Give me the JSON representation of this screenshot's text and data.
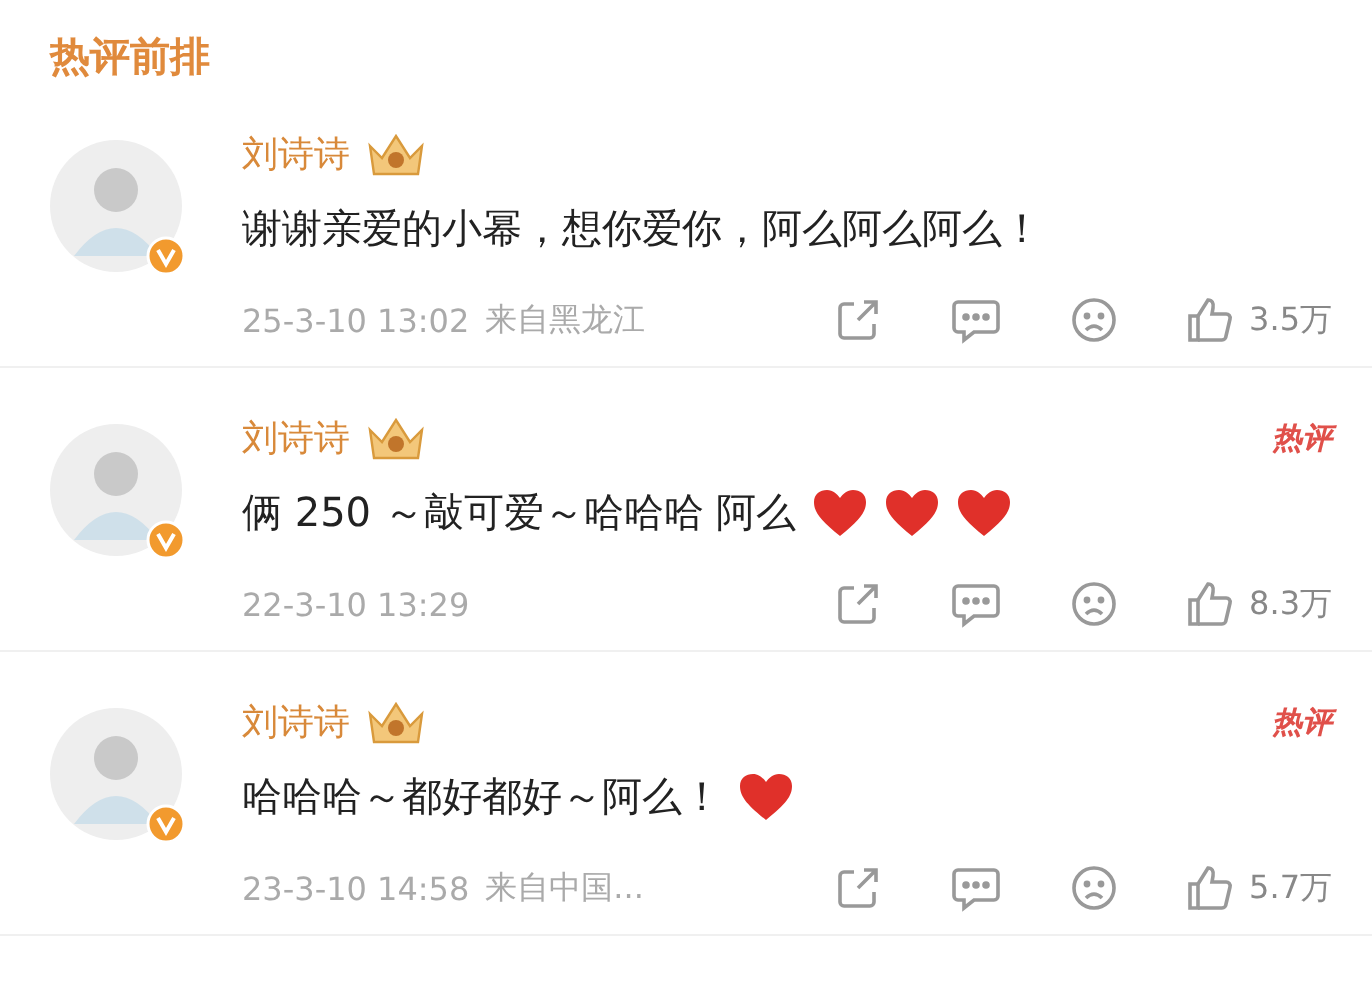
{
  "header": {
    "title": "热评前排"
  },
  "comments": [
    {
      "user": "刘诗诗",
      "verified": true,
      "text": "谢谢亲爱的小幂，想你爱你，阿么阿么阿么！",
      "date": "25-3-10 13:02",
      "location": "来自黑龙江",
      "likes": "3.5万"
    },
    {
      "user": "刘诗诗",
      "verified": true,
      "badge": "热评",
      "text": "俩 250 ～敲可爱～哈哈哈 阿么",
      "emoji": [
        {
          "kind": "heart"
        },
        {
          "kind": "heart"
        },
        {
          "kind": "heart"
        }
      ],
      "date": "22-3-10 13:29",
      "likes": "8.3万"
    },
    {
      "user": "刘诗诗",
      "verified": true,
      "badge": "热评",
      "text": "哈哈哈～都好都好～阿么！",
      "emoji": [
        {
          "kind": "heart"
        }
      ],
      "date": "23-3-10 14:58",
      "location": "来自中国...",
      "likes": "5.7万"
    }
  ]
}
